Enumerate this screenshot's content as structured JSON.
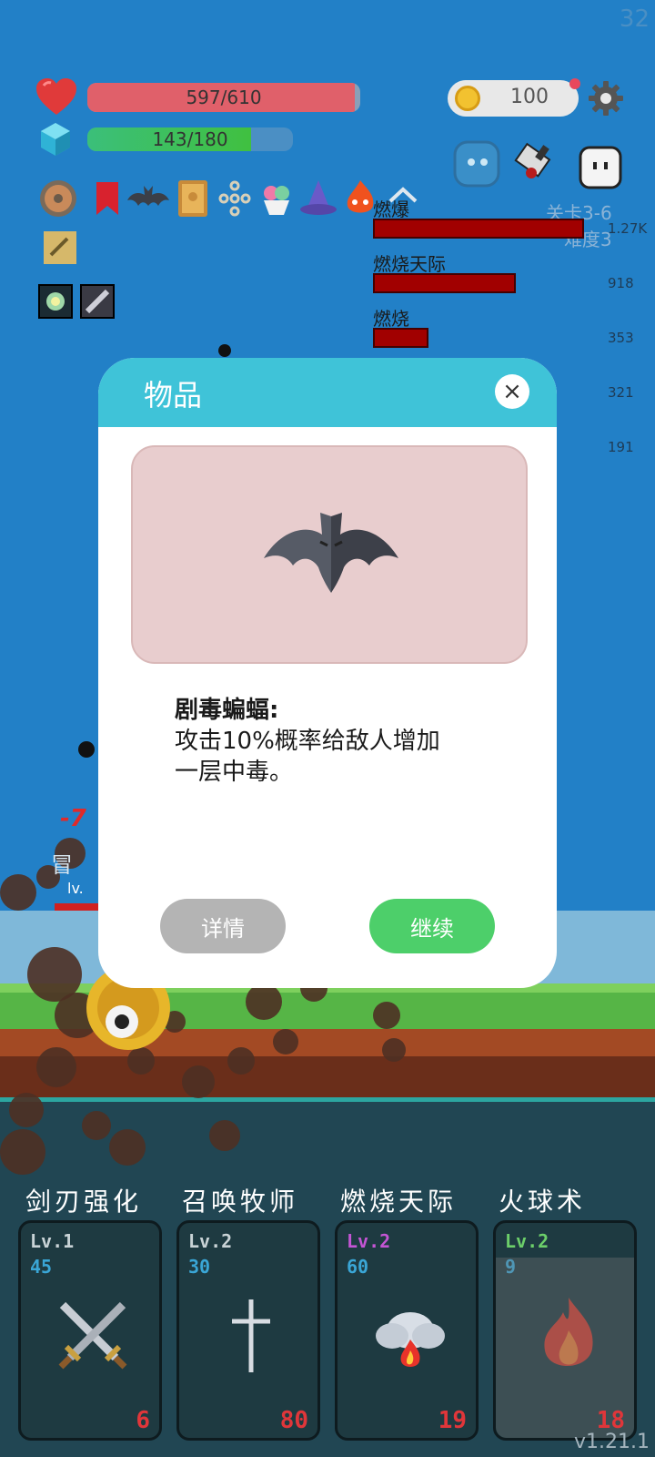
{
  "fps": "32",
  "hud": {
    "hp": {
      "current": 597,
      "max": 610,
      "label": "597/610"
    },
    "mp": {
      "current": 143,
      "max": 180,
      "label": "143/180"
    },
    "coins": "100",
    "icons": [
      "shield-icon",
      "bookmark-icon",
      "bat-icon",
      "spellbook-icon",
      "chain-icon",
      "ice-cream-icon",
      "wizard-hat-icon",
      "fire-spirit-icon",
      "map-icon",
      "crystal-card-icon",
      "blade-card-icon"
    ]
  },
  "enemies": [
    "ghost-enemy-icon",
    "butcher-knife-enemy-icon",
    "white-blob-enemy-icon"
  ],
  "level": {
    "stage": "关卡3-6",
    "difficulty": "难度3"
  },
  "damage_meter": [
    {
      "label": "燃爆",
      "value": "1.27K",
      "fraction": 0.8
    },
    {
      "label": "燃烧天际",
      "value": "918",
      "fraction": 0.54
    },
    {
      "label": "燃烧",
      "value": "353",
      "fraction": 0.21
    },
    {
      "label": "",
      "value": "321",
      "fraction": 0
    },
    {
      "label": "",
      "value": "191",
      "fraction": 0
    }
  ],
  "modal": {
    "title": "物品",
    "close": "×",
    "item_title": "剧毒蝙蝠:",
    "item_desc_line1": "攻击10%概率给敌人增加",
    "item_desc_line2": "一层中毒。",
    "detail_button": "详情",
    "continue_button": "继续"
  },
  "battle": {
    "damage_popup": "-7",
    "hero_label": "冒",
    "hero_level": "lv."
  },
  "skills": [
    {
      "name": "剑刃强化",
      "level": "Lv.1",
      "level_color": "#c9d3d6",
      "cost": "45",
      "count": "6",
      "icon": "crossed-swords-icon"
    },
    {
      "name": "召唤牧师",
      "level": "Lv.2",
      "level_color": "#c9d3d6",
      "cost": "30",
      "count": "80",
      "icon": "cross-icon"
    },
    {
      "name": "燃烧天际",
      "level": "Lv.2",
      "level_color": "#c455d4",
      "cost": "60",
      "count": "19",
      "icon": "fire-cloud-icon"
    },
    {
      "name": "火球术",
      "level": "Lv.2",
      "level_color": "#6ccf6a",
      "cost": "9",
      "count": "18",
      "icon": "flame-icon"
    }
  ],
  "version": "v1.21.1"
}
